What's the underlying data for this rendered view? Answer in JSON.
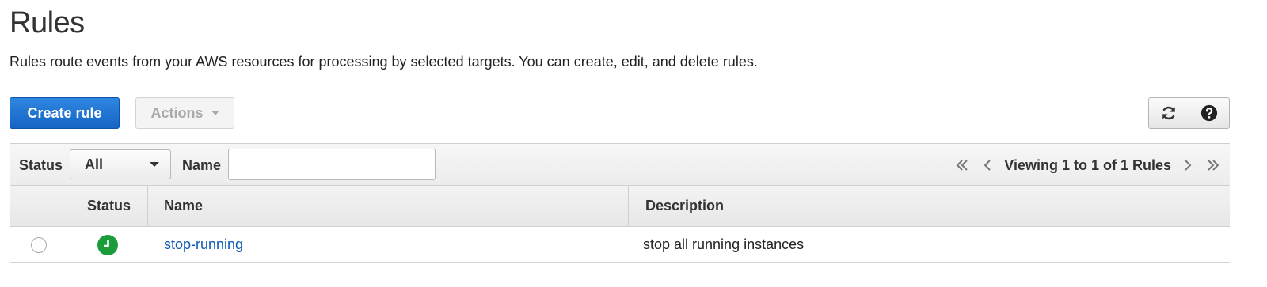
{
  "page": {
    "title": "Rules",
    "subtitle": "Rules route events from your AWS resources for processing by selected targets. You can create, edit, and delete rules."
  },
  "toolbar": {
    "create_label": "Create rule",
    "actions_label": "Actions",
    "refresh_icon": "refresh-icon",
    "help_icon": "help-icon"
  },
  "filter": {
    "status_label": "Status",
    "status_value": "All",
    "name_label": "Name",
    "name_value": "",
    "name_placeholder": ""
  },
  "pagination": {
    "text": "Viewing 1 to 1 of 1 Rules"
  },
  "table": {
    "columns": [
      "Status",
      "Name",
      "Description"
    ],
    "rows": [
      {
        "selected": false,
        "status": "enabled",
        "name": "stop-running",
        "description": "stop all running instances"
      }
    ]
  },
  "colors": {
    "primary": "#1f74d1",
    "status_enabled": "#1a9c3a",
    "link": "#0b5bb5"
  }
}
